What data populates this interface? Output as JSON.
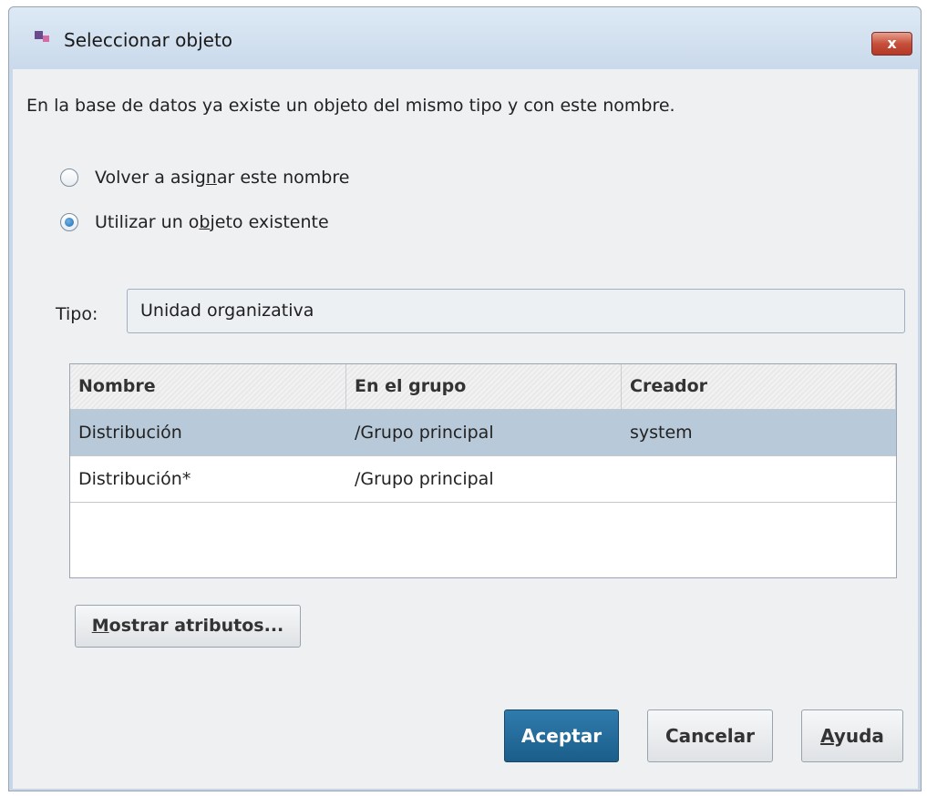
{
  "window": {
    "title": "Seleccionar objeto",
    "close_glyph": "x",
    "app_icon": "app-icon"
  },
  "message": "En la base de datos ya existe un objeto del mismo tipo y con este nombre.",
  "options": [
    {
      "label_pre": "Volver a asig",
      "label_mnemonic": "n",
      "label_post": "ar este nombre",
      "selected": false
    },
    {
      "label_pre": "Utilizar un o",
      "label_mnemonic": "b",
      "label_post": "jeto existente",
      "selected": true
    }
  ],
  "tipo": {
    "label": "Tipo:",
    "value": "Unidad organizativa"
  },
  "table": {
    "columns": [
      "Nombre",
      "En el grupo",
      "Creador"
    ],
    "rows": [
      {
        "nombre": "Distribución",
        "grupo": "/Grupo principal",
        "creador": "system",
        "selected": true
      },
      {
        "nombre": "Distribución*",
        "grupo": "/Grupo principal",
        "creador": "",
        "selected": false
      }
    ]
  },
  "buttons": {
    "mostrar_mnemonic": "M",
    "mostrar_rest": "ostrar atributos...",
    "aceptar": "Aceptar",
    "cancelar": "Cancelar",
    "ayuda_mnemonic": "A",
    "ayuda_rest": "yuda"
  },
  "colors": {
    "primary_button": "#1b5e8a",
    "selected_row": "#b8c9d9",
    "close_button": "#c64f3b"
  }
}
